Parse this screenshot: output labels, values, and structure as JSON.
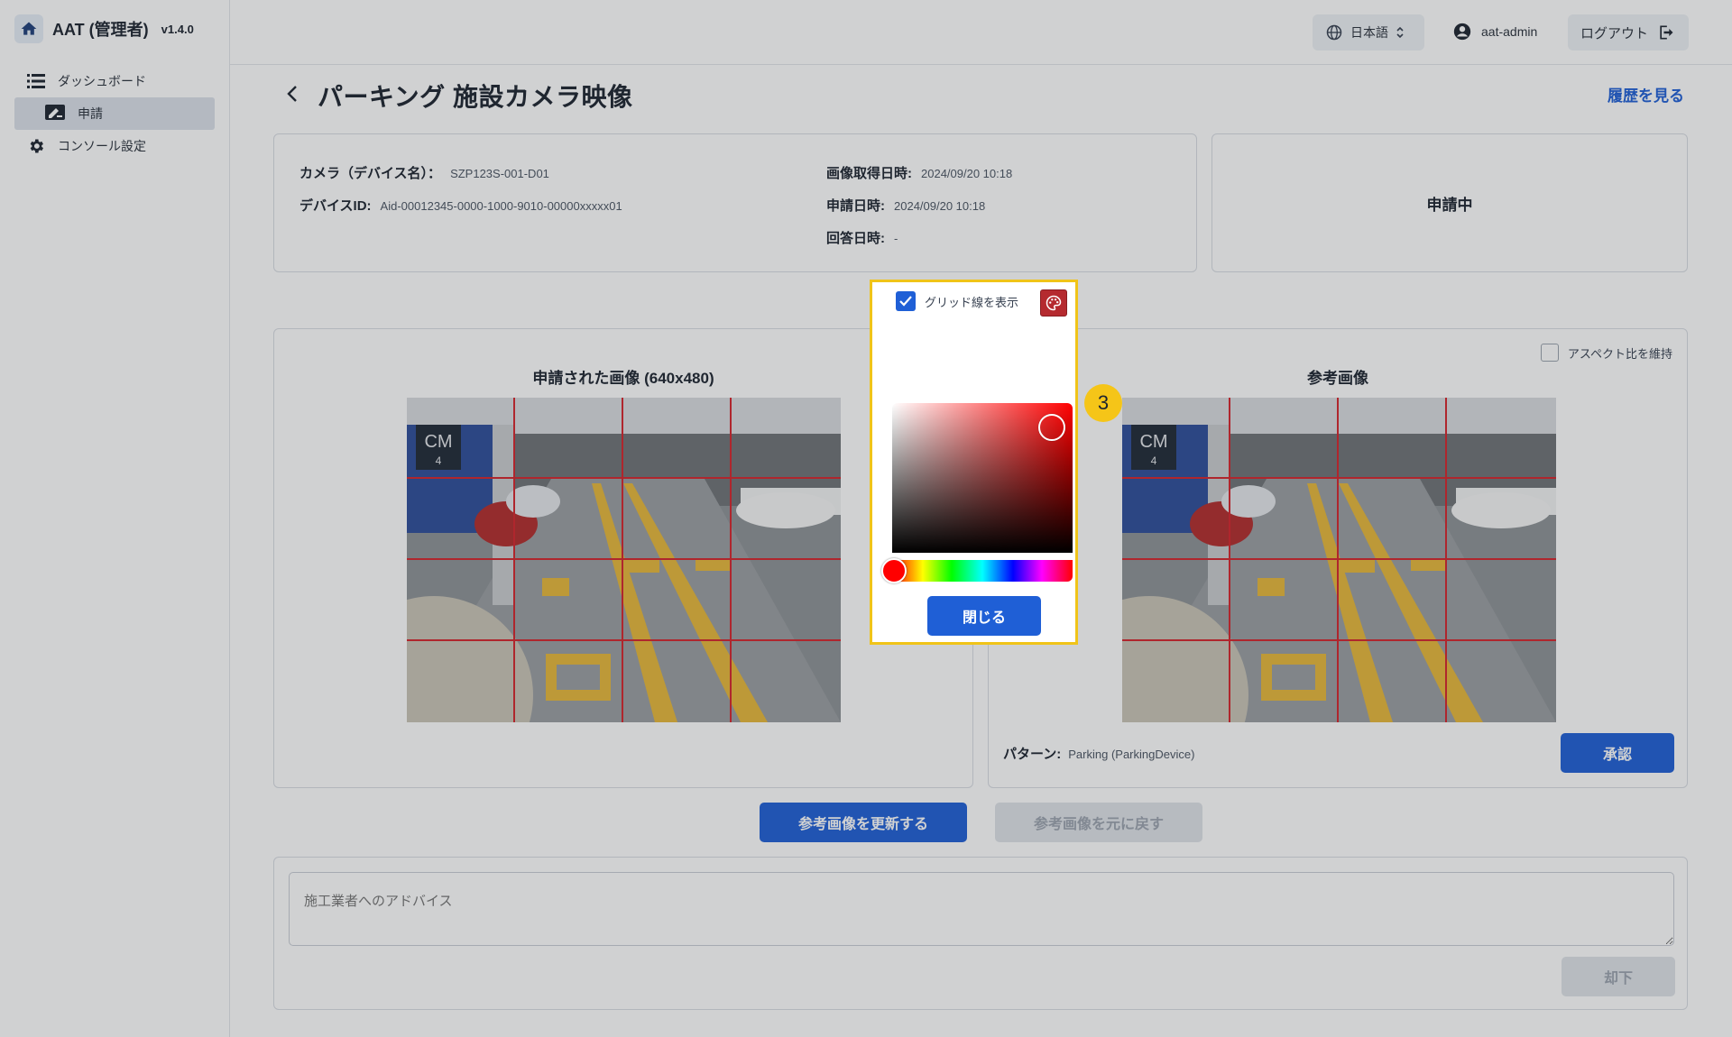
{
  "app": {
    "title": "AAT (管理者)",
    "version": "v1.4.0"
  },
  "sidebar": {
    "items": [
      {
        "label": "ダッシュボード"
      },
      {
        "label": "申請"
      },
      {
        "label": "コンソール設定"
      }
    ]
  },
  "header": {
    "language": "日本語",
    "user": "aat-admin",
    "logout": "ログアウト"
  },
  "page": {
    "title": "パーキング 施設カメラ映像",
    "history_link": "履歴を見る"
  },
  "info": {
    "camera_label": "カメラ（デバイス名）：",
    "camera_value": "SZP123S-001-D01",
    "device_id_label": "デバイスID:",
    "device_id_value": "Aid-00012345-0000-1000-9010-00000xxxxx01",
    "image_time_label": "画像取得日時:",
    "image_time_value": "2024/09/20 10:18",
    "request_date_label": "申請日時:",
    "request_date_value": "2024/09/20 10:18",
    "answer_date_label": "回答日時:",
    "answer_date_value": "-"
  },
  "status": {
    "label": "申請中"
  },
  "grid_toggle": {
    "label": "グリッド線を表示",
    "checked": true,
    "color": "#d5252c"
  },
  "color_picker": {
    "hue": "#ff0000",
    "close_label": "閉じる"
  },
  "step_badge": "3",
  "submitted_image": {
    "title": "申請された画像 (640x480)"
  },
  "reference_image": {
    "title": "参考画像",
    "keep_aspect_label": "アスペクト比を維持",
    "pattern_label": "パターン:",
    "pattern_value": "Parking (ParkingDevice)",
    "approve_label": "承認"
  },
  "actions": {
    "update_reference": "参考画像を更新する",
    "restore_reference": "参考画像を元に戻す"
  },
  "advice": {
    "placeholder": "施工業者へのアドバイス",
    "reject_label": "却下"
  },
  "photo_label": {
    "line1": "CM",
    "line2": "4"
  },
  "colors": {
    "accent": "#1f5fd6",
    "highlight": "#f0c419",
    "grid": "#d5252c"
  }
}
